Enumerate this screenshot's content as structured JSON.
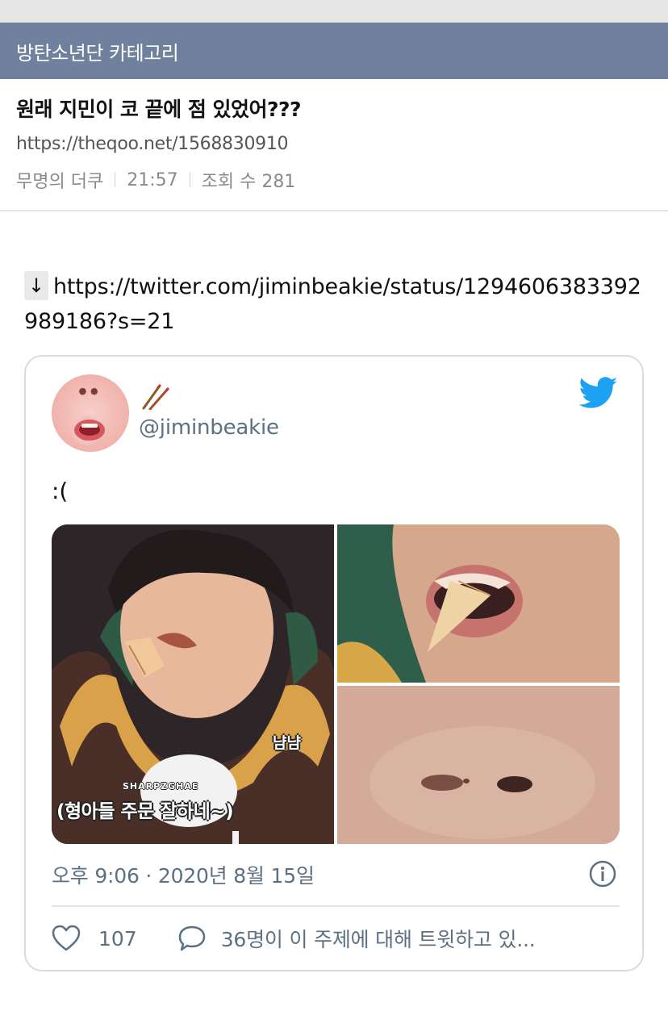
{
  "category": {
    "label": "방탄소년단 카테고리"
  },
  "post": {
    "title": "원래 지민이 코 끝에 점 있었어???",
    "url": "https://theqoo.net/1568830910",
    "author": "무명의 더쿠",
    "time": "21:57",
    "views": "조회 수 281"
  },
  "content": {
    "arrow": "↓",
    "link": "https://twitter.com/jiminbeakie/status/1294606383392989186?s=21"
  },
  "tweet": {
    "handle": "@jiminbeakie",
    "text": ":(",
    "media": {
      "subtitle_main": "(형아들 주문 잘하네~)",
      "subtitle_small": "냠냠",
      "watermark": "SHARPZGHAE"
    },
    "timestamp": "오후 9:06 · 2020년 8월 15일",
    "likes": "107",
    "talking": "36명이 이 주제에 대해 트윗하고 있..."
  },
  "colors": {
    "category_bar": "#6f819d",
    "twitter_blue": "#1da1f2",
    "secondary_text": "#5b7083",
    "card_border": "#d5dde4"
  },
  "icons": [
    "down-arrow-icon",
    "twitter-bird-icon",
    "chopsticks-icon",
    "info-icon",
    "heart-icon",
    "comment-bubble-icon"
  ]
}
